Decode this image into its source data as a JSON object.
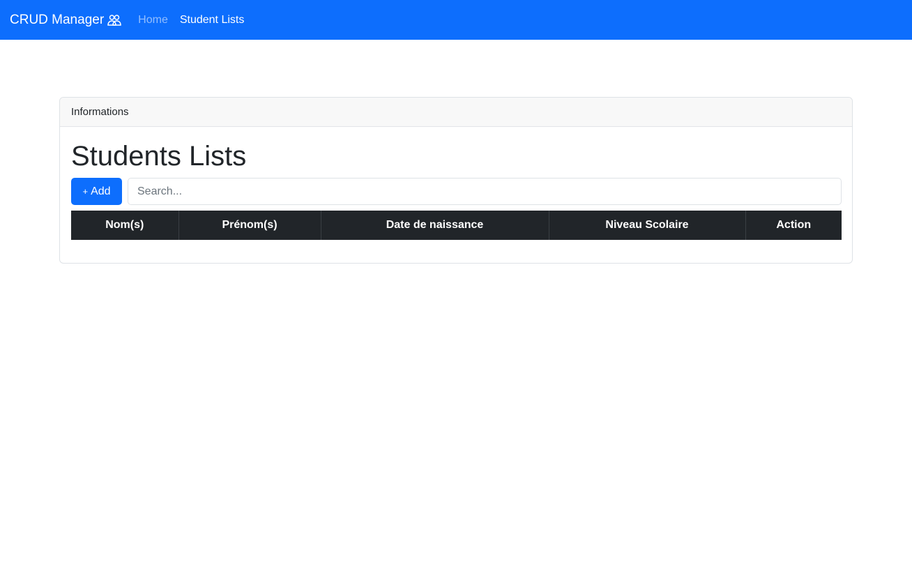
{
  "navbar": {
    "brand": "CRUD Manager",
    "brand_icon": "people-icon",
    "links": [
      "Home",
      "Student Lists"
    ],
    "color": "#0d6efd"
  },
  "card": {
    "header": "Informations",
    "title": "Students Lists",
    "add_button": {
      "icon": "+",
      "label": "Add"
    },
    "search": {
      "placeholder": "Search...",
      "value": ""
    },
    "table": {
      "headers": [
        "Nom(s)",
        "Prénom(s)",
        "Date de naissance",
        "Niveau Scolaire",
        "Action"
      ],
      "rows": []
    }
  }
}
